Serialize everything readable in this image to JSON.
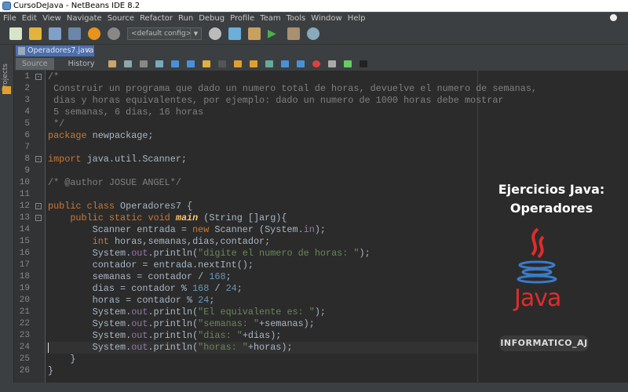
{
  "window": {
    "title": "CursoDeJava - NetBeans IDE 8.2"
  },
  "menu": [
    "File",
    "Edit",
    "View",
    "Navigate",
    "Source",
    "Refactor",
    "Run",
    "Debug",
    "Profile",
    "Team",
    "Tools",
    "Window",
    "Help"
  ],
  "toolbar": {
    "config": "<default config>"
  },
  "editor": {
    "tab": "Operadores7.java",
    "source_tab": "Source",
    "history_tab": "History",
    "projects_label": "Projects"
  },
  "code": [
    [
      [
        "/*",
        "c"
      ]
    ],
    [
      [
        " Construir un programa que dado un numero total de horas, devuelve el numero de semanas,",
        "c"
      ]
    ],
    [
      [
        " dias y horas equivalentes, por ejemplo: dado un numero de 1000 horas debe mostrar",
        "c"
      ]
    ],
    [
      [
        " 5 semanas, 6 dias, 16 horas",
        "c"
      ]
    ],
    [
      [
        " */",
        "c"
      ]
    ],
    [
      [
        "package",
        "k"
      ],
      [
        " newpackage;",
        ""
      ]
    ],
    [],
    [
      [
        "import",
        "k"
      ],
      [
        " java.util.Scanner;",
        ""
      ]
    ],
    [],
    [
      [
        "/* @author JOSUE ANGEL*/",
        "c"
      ]
    ],
    [],
    [
      [
        "public class",
        "k"
      ],
      [
        " Operadores7 {",
        ""
      ]
    ],
    [
      [
        "    ",
        ""
      ],
      [
        "public static void",
        "k"
      ],
      [
        " ",
        ""
      ],
      [
        "main",
        "m"
      ],
      [
        " (String []arg){",
        ""
      ]
    ],
    [
      [
        "        Scanner entrada = ",
        ""
      ],
      [
        "new",
        "k"
      ],
      [
        " Scanner (System.",
        ""
      ],
      [
        "in",
        "f"
      ],
      [
        ");",
        ""
      ]
    ],
    [
      [
        "        ",
        ""
      ],
      [
        "int",
        "k"
      ],
      [
        " horas,semanas,dias,contador;",
        ""
      ]
    ],
    [
      [
        "        System.",
        ""
      ],
      [
        "out",
        "f"
      ],
      [
        ".println(",
        ""
      ],
      [
        "\"digite el numero de horas: \"",
        "s"
      ],
      [
        ");",
        ""
      ]
    ],
    [
      [
        "        contador = entrada.nextInt();",
        ""
      ]
    ],
    [
      [
        "        semanas = contador / ",
        ""
      ],
      [
        "168",
        "n"
      ],
      [
        ";",
        ""
      ]
    ],
    [
      [
        "        dias = contador % ",
        ""
      ],
      [
        "168",
        "n"
      ],
      [
        " / ",
        ""
      ],
      [
        "24",
        "n"
      ],
      [
        ";",
        ""
      ]
    ],
    [
      [
        "        horas = contador % ",
        ""
      ],
      [
        "24",
        "n"
      ],
      [
        ";",
        ""
      ]
    ],
    [
      [
        "        System.",
        ""
      ],
      [
        "out",
        "f"
      ],
      [
        ".println(",
        ""
      ],
      [
        "\"El equivalente es: \"",
        "s"
      ],
      [
        ");",
        ""
      ]
    ],
    [
      [
        "        System.",
        ""
      ],
      [
        "out",
        "f"
      ],
      [
        ".println(",
        ""
      ],
      [
        "\"semanas: \"",
        "s"
      ],
      [
        "+semanas);",
        ""
      ]
    ],
    [
      [
        "        System.",
        ""
      ],
      [
        "out",
        "f"
      ],
      [
        ".println(",
        ""
      ],
      [
        "\"dias: \"",
        "s"
      ],
      [
        "+dias);",
        ""
      ]
    ],
    [
      [
        "        System.",
        ""
      ],
      [
        "out",
        "f"
      ],
      [
        ".println(",
        ""
      ],
      [
        "\"horas: \"",
        "s"
      ],
      [
        "+horas);",
        ""
      ]
    ],
    [
      [
        "    }",
        ""
      ]
    ],
    [
      [
        "}",
        ""
      ]
    ]
  ],
  "overlay": {
    "title_line1": "Ejercicios Java:",
    "title_line2": "Operadores",
    "java_logo": "Java",
    "brand": "INFORMATICO_AJ"
  }
}
